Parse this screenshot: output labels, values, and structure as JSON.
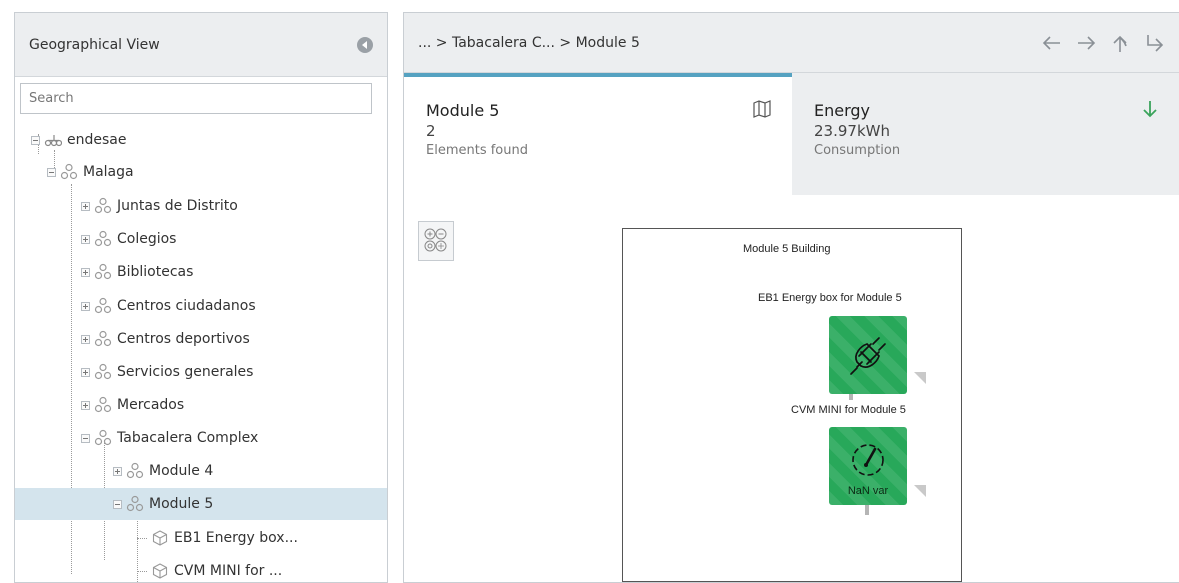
{
  "left_panel": {
    "title": "Geographical View",
    "search": {
      "placeholder": "Search",
      "value": ""
    },
    "tree": [
      {
        "label": "endesae",
        "icon": "network-icon",
        "expanded": true
      },
      {
        "label": "Malaga",
        "icon": "sitemap-icon",
        "expanded": true
      },
      {
        "label": "Juntas de Distrito",
        "icon": "sitemap-icon",
        "expanded": false
      },
      {
        "label": "Colegios",
        "icon": "sitemap-icon",
        "expanded": false
      },
      {
        "label": "Bibliotecas",
        "icon": "sitemap-icon",
        "expanded": false
      },
      {
        "label": "Centros ciudadanos",
        "icon": "sitemap-icon",
        "expanded": false
      },
      {
        "label": "Centros deportivos",
        "icon": "sitemap-icon",
        "expanded": false
      },
      {
        "label": "Servicios generales",
        "icon": "sitemap-icon",
        "expanded": false
      },
      {
        "label": "Mercados",
        "icon": "sitemap-icon",
        "expanded": false
      },
      {
        "label": "Tabacalera Complex",
        "icon": "sitemap-icon",
        "expanded": true
      },
      {
        "label": "Module 4",
        "icon": "sitemap-icon",
        "expanded": false
      },
      {
        "label": "Module 5",
        "icon": "sitemap-icon",
        "expanded": true,
        "selected": true
      },
      {
        "label": "EB1 Energy box...",
        "icon": "cube-icon"
      },
      {
        "label": "CVM MINI for ...",
        "icon": "cube-icon"
      }
    ]
  },
  "right_panel": {
    "breadcrumb": "... > Tabacalera C... > Module 5",
    "nav_icons": [
      "back-arrow-icon",
      "forward-arrow-icon",
      "up-arrow-icon",
      "redirect-arrow-icon"
    ],
    "module_tile": {
      "title": "Module 5",
      "value": "2",
      "subtitle": "Elements found",
      "icon": "map-icon"
    },
    "energy_tile": {
      "title": "Energy",
      "value": "23.97kWh",
      "subtitle": "Consumption",
      "icon": "down-arrow-icon",
      "icon_color": "#3aa35b"
    },
    "canvas": {
      "title": "Module 5 Building",
      "devices": [
        {
          "label": "EB1 Energy box for Module 5",
          "icon": "plug-icon",
          "color": "#28a85a"
        },
        {
          "label": "CVM MINI for Module 5",
          "icon": "gauge-icon",
          "color": "#28a85a",
          "reading": "NaN var"
        }
      ]
    }
  },
  "colors": {
    "accent": "#55a2c1",
    "selected_row": "#d4e4ed",
    "device_green": "#28a85a"
  }
}
